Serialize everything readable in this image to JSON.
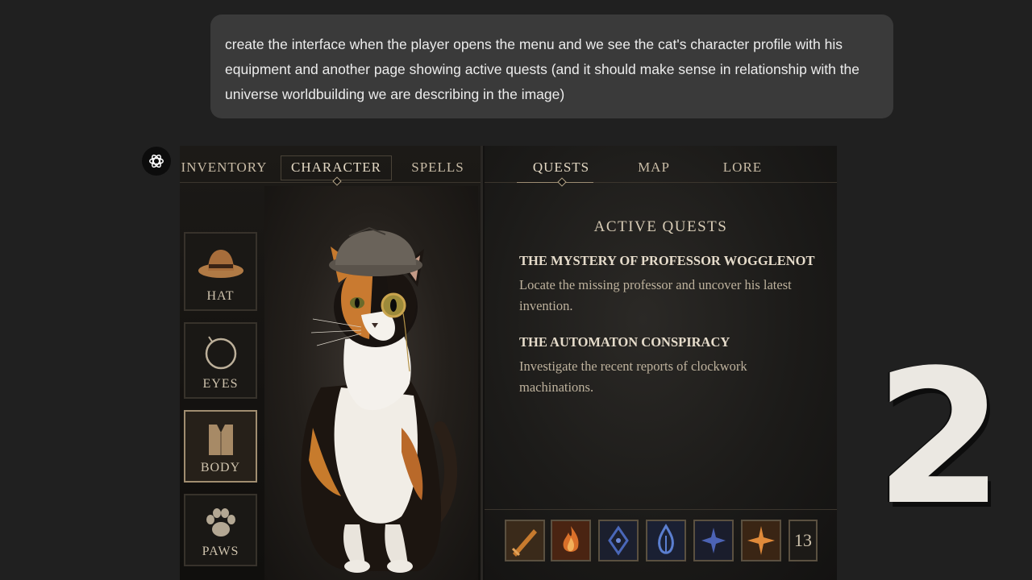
{
  "prompt": {
    "text": "create the interface when the player opens the menu and we see the cat's character profile with his equipment and another page showing active quests (and it should make sense in relationship with the universe worldbuilding we are describing in the image)"
  },
  "assistant": {
    "icon": "openai-logo-icon"
  },
  "game_menu": {
    "left_tabs": [
      {
        "label": "INVENTORY",
        "active": false
      },
      {
        "label": "CHARACTER",
        "active": true
      },
      {
        "label": "SPELLS",
        "active": false
      }
    ],
    "right_tabs": [
      {
        "label": "QUESTS",
        "active": true
      },
      {
        "label": "MAP",
        "active": false
      },
      {
        "label": "LORE",
        "active": false
      }
    ],
    "equipment_slots": [
      {
        "label": "HAT",
        "icon": "hat-icon",
        "selected": false
      },
      {
        "label": "EYES",
        "icon": "monocle-icon",
        "selected": false
      },
      {
        "label": "BODY",
        "icon": "vest-icon",
        "selected": true
      },
      {
        "label": "PAWS",
        "icon": "paw-icon",
        "selected": false
      }
    ],
    "quests": {
      "title": "ACTIVE QUESTS",
      "items": [
        {
          "name": "THE MYSTERY OF PROFESSOR WOGGLENOT",
          "description": "Locate the missing professor and uncover his latest invention."
        },
        {
          "name": "THE AUTOMATON CONSPIRACY",
          "description": "Investigate the recent reports of clockwork machinations."
        }
      ]
    },
    "hotbar": {
      "slots": [
        {
          "icon": "sword-icon",
          "color": "#c77a2e"
        },
        {
          "icon": "fire-icon",
          "color": "#d9702a"
        },
        {
          "icon": "blue-rune-icon",
          "color": "#4a67b8"
        },
        {
          "icon": "blue-flame-icon",
          "color": "#5b7fd0"
        },
        {
          "icon": "blue-star-icon",
          "color": "#4c63b4"
        },
        {
          "icon": "orange-star-icon",
          "color": "#e08a3a"
        }
      ],
      "count": "13"
    }
  },
  "overlay_number": "2"
}
